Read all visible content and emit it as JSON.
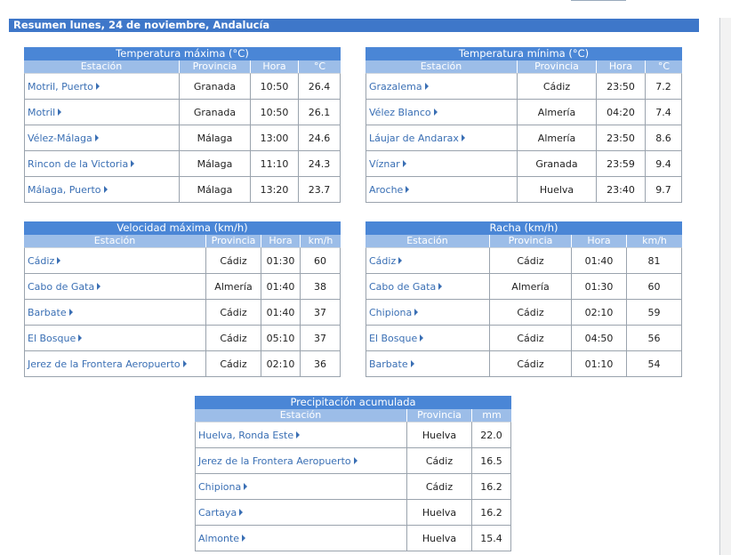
{
  "header": {
    "title": "Resumen lunes, 24 de noviembre, Andalucía"
  },
  "tables": {
    "tmax": {
      "title": "Temperatura máxima (°C)",
      "cols": [
        "Estación",
        "Provincia",
        "Hora",
        "°C"
      ],
      "rows": [
        [
          "Motril, Puerto",
          "Granada",
          "10:50",
          "26.4"
        ],
        [
          "Motril",
          "Granada",
          "10:50",
          "26.1"
        ],
        [
          "Vélez-Málaga",
          "Málaga",
          "13:00",
          "24.6"
        ],
        [
          "Rincon de la Victoria",
          "Málaga",
          "11:10",
          "24.3"
        ],
        [
          "Málaga, Puerto",
          "Málaga",
          "13:20",
          "23.7"
        ]
      ]
    },
    "tmin": {
      "title": "Temperatura mínima (°C)",
      "cols": [
        "Estación",
        "Provincia",
        "Hora",
        "°C"
      ],
      "rows": [
        [
          "Grazalema",
          "Cádiz",
          "23:50",
          "7.2"
        ],
        [
          "Vélez Blanco",
          "Almería",
          "04:20",
          "7.4"
        ],
        [
          "Láujar de Andarax",
          "Almería",
          "23:50",
          "8.6"
        ],
        [
          "Víznar",
          "Granada",
          "23:59",
          "9.4"
        ],
        [
          "Aroche",
          "Huelva",
          "23:40",
          "9.7"
        ]
      ]
    },
    "vmax": {
      "title": "Velocidad máxima (km/h)",
      "cols": [
        "Estación",
        "Provincia",
        "Hora",
        "km/h"
      ],
      "rows": [
        [
          "Cádiz",
          "Cádiz",
          "01:30",
          "60"
        ],
        [
          "Cabo de Gata",
          "Almería",
          "01:40",
          "38"
        ],
        [
          "Barbate",
          "Cádiz",
          "01:40",
          "37"
        ],
        [
          "El Bosque",
          "Cádiz",
          "05:10",
          "37"
        ],
        [
          "Jerez de la Frontera Aeropuerto",
          "Cádiz",
          "02:10",
          "36"
        ]
      ]
    },
    "racha": {
      "title": "Racha (km/h)",
      "cols": [
        "Estación",
        "Provincia",
        "Hora",
        "km/h"
      ],
      "rows": [
        [
          "Cádiz",
          "Cádiz",
          "01:40",
          "81"
        ],
        [
          "Cabo de Gata",
          "Almería",
          "01:30",
          "60"
        ],
        [
          "Chipiona",
          "Cádiz",
          "02:10",
          "59"
        ],
        [
          "El Bosque",
          "Cádiz",
          "04:50",
          "56"
        ],
        [
          "Barbate",
          "Cádiz",
          "01:10",
          "54"
        ]
      ]
    },
    "precip": {
      "title": "Precipitación acumulada",
      "cols": [
        "Estación",
        "Provincia",
        "mm"
      ],
      "rows": [
        [
          "Huelva, Ronda Este",
          "Huelva",
          "22.0"
        ],
        [
          "Jerez de la Frontera Aeropuerto",
          "Cádiz",
          "16.5"
        ],
        [
          "Chipiona",
          "Cádiz",
          "16.2"
        ],
        [
          "Cartaya",
          "Huelva",
          "16.2"
        ],
        [
          "Almonte",
          "Huelva",
          "15.4"
        ]
      ]
    }
  }
}
